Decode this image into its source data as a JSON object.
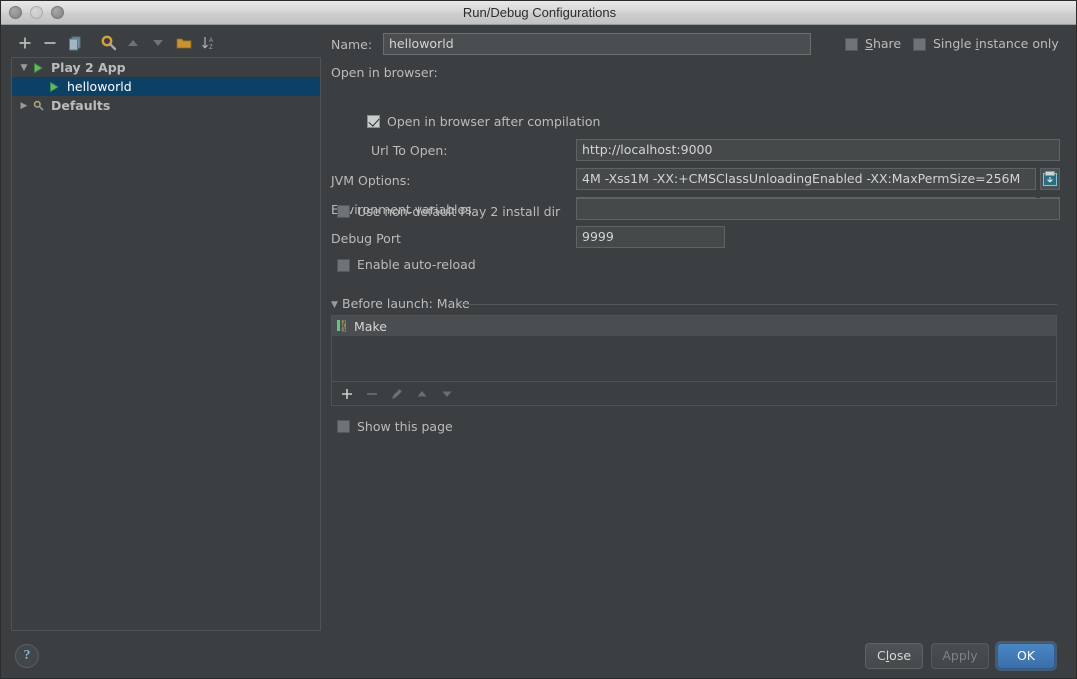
{
  "window": {
    "title": "Run/Debug Configurations",
    "controls": [
      "close-button",
      "minimize-button",
      "maximize-button"
    ]
  },
  "left_panel": {
    "toolbar": [
      {
        "name": "add-configuration-button",
        "icon": "plus-icon",
        "label": "+"
      },
      {
        "name": "remove-configuration-button",
        "icon": "minus-icon",
        "label": "−"
      },
      {
        "name": "copy-configuration-button",
        "icon": "copy-icon",
        "label": ""
      },
      {
        "name": "edit-defaults-button",
        "icon": "wrench-gear-icon",
        "label": ""
      },
      {
        "name": "move-up-button",
        "icon": "arrow-up-icon",
        "label": ""
      },
      {
        "name": "move-down-button",
        "icon": "arrow-down-icon",
        "label": ""
      },
      {
        "name": "create-folder-button",
        "icon": "folder-icon",
        "label": ""
      },
      {
        "name": "sort-configurations-button",
        "icon": "sort-az-icon",
        "label": ""
      }
    ],
    "tree": [
      {
        "label": "Play 2 App",
        "icon": "play-green-icon",
        "twisty": "▼",
        "indent": 0,
        "selected": false,
        "bold": true
      },
      {
        "label": "helloworld",
        "icon": "play-green-icon",
        "twisty": "",
        "indent": 1,
        "selected": true,
        "bold": false
      },
      {
        "label": "Defaults",
        "icon": "wrench-gear-icon",
        "twisty": "▶",
        "indent": 0,
        "selected": false,
        "bold": true
      }
    ]
  },
  "form": {
    "name_label": "Name:",
    "name_value": "helloworld",
    "share": {
      "label_pre": "",
      "label_mnemonic": "S",
      "label_post": "hare",
      "checked": false
    },
    "single_instance": {
      "label_pre": "Single ",
      "label_mnemonic": "i",
      "label_post": "nstance only",
      "checked": false
    },
    "open_in_browser_label": "Open in browser:",
    "open_in_browser_after_compilation": {
      "label": "Open in browser after compilation",
      "checked": true
    },
    "url_label": "Url To Open:",
    "url_value": "http://localhost:9000",
    "jvm_label": "JVM Options:",
    "jvm_value": "4M -Xss1M -XX:+CMSClassUnloadingEnabled -XX:MaxPermSize=256M",
    "jvm_expand_icon": "expand-editor-icon",
    "env_label": "Environment variables",
    "env_value": "",
    "env_browse_label": "...",
    "install_dir": {
      "label": "Use non-default Play 2 install dir",
      "checked": false,
      "value": ""
    },
    "debug_port_label": "Debug Port",
    "debug_port_value": "9999",
    "auto_reload": {
      "label": "Enable auto-reload",
      "checked": false
    },
    "before_launch_title": "Before launch: Make",
    "before_launch_twisty": "▼",
    "before_launch_items": [
      {
        "label": "Make",
        "icon": "make-compile-icon"
      }
    ],
    "before_launch_toolbar": [
      {
        "name": "add-task-button",
        "icon": "plus-icon",
        "enabled": true
      },
      {
        "name": "remove-task-button",
        "icon": "minus-icon",
        "enabled": false
      },
      {
        "name": "edit-task-button",
        "icon": "pencil-icon",
        "enabled": false
      },
      {
        "name": "move-task-up-button",
        "icon": "arrow-up-icon",
        "enabled": false
      },
      {
        "name": "move-task-down-button",
        "icon": "arrow-down-icon",
        "enabled": false
      }
    ],
    "show_this_page": {
      "label": "Show this page",
      "checked": false
    }
  },
  "footer": {
    "help_label": "?",
    "close": {
      "label_pre": "C",
      "label_mnemonic": "l",
      "label_post": "ose"
    },
    "apply_label": "Apply",
    "ok_label": "OK"
  },
  "colors": {
    "background": "#3c3f41",
    "field_bg": "#45494a",
    "selection": "#0d4065",
    "accent_green": "#62b862",
    "primary_button": "#4a86c4",
    "text": "#bbbbbb"
  }
}
